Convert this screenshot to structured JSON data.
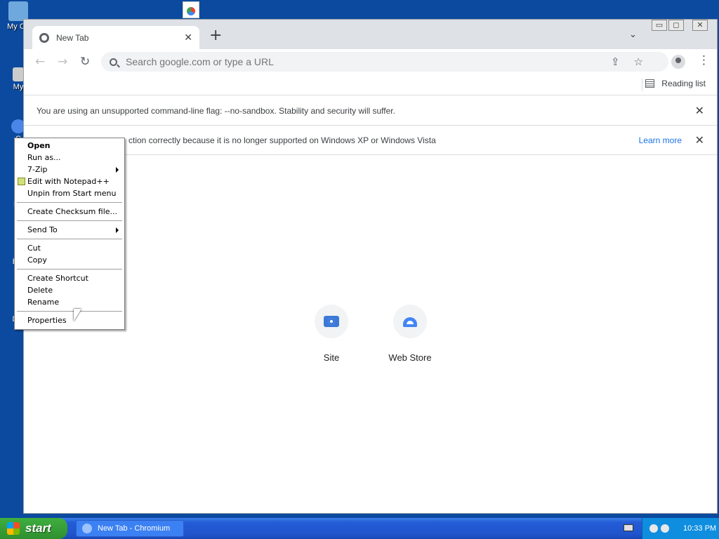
{
  "desktop": {
    "icons": [
      {
        "label": "My Co",
        "color": "#6fa8dc"
      },
      {
        "label": "My",
        "color": "#cccccc"
      },
      {
        "label": "C",
        "color": "#4a86e8"
      },
      {
        "label": "No",
        "color": ""
      },
      {
        "label": "Em",
        "color": ""
      },
      {
        "label": "D",
        "color": ""
      },
      {
        "label": "Dat",
        "color": ""
      }
    ]
  },
  "browser": {
    "tab_title": "New Tab",
    "tab_close": "✕",
    "new_tab": "+",
    "tab_search": "⌄",
    "window_controls": [
      "▭",
      "◻",
      "✕"
    ],
    "back": "←",
    "forward": "→",
    "reload": "↻",
    "omnibox_placeholder": "Search google.com or type a URL",
    "omnibox_actions": "⇪☆",
    "menu": "⋮",
    "reading_list": "Reading list",
    "infobars": [
      {
        "text": "You are using an unsupported command-line flag: --no-sandbox. Stability and security will suffer.",
        "close": "✕"
      },
      {
        "text": "ction correctly because it is no longer supported on Windows XP or Windows Vista",
        "link": "Learn more",
        "close": "✕"
      }
    ],
    "shortcuts": [
      {
        "label": "Site",
        "icon": "camera-icon"
      },
      {
        "label": "Web Store",
        "icon": "web-store-icon"
      }
    ]
  },
  "context_menu": {
    "items": [
      {
        "label": "Open",
        "bold": true
      },
      {
        "label": "Run as..."
      },
      {
        "label": "7-Zip",
        "submenu": true
      },
      {
        "label": "Edit with Notepad++",
        "icon": "notepad-plus-plus-icon"
      },
      {
        "label": "Unpin from Start menu"
      },
      {
        "separator": true
      },
      {
        "label": "Create Checksum file..."
      },
      {
        "separator": true
      },
      {
        "label": "Send To",
        "submenu": true
      },
      {
        "separator": true
      },
      {
        "label": "Cut"
      },
      {
        "label": "Copy"
      },
      {
        "separator": true
      },
      {
        "label": "Create Shortcut"
      },
      {
        "label": "Delete"
      },
      {
        "label": "Rename"
      },
      {
        "separator": true
      },
      {
        "label": "Properties"
      }
    ]
  },
  "taskbar": {
    "start_label": "start",
    "task_label": "New Tab - Chromium",
    "clock": "10:33 PM"
  }
}
